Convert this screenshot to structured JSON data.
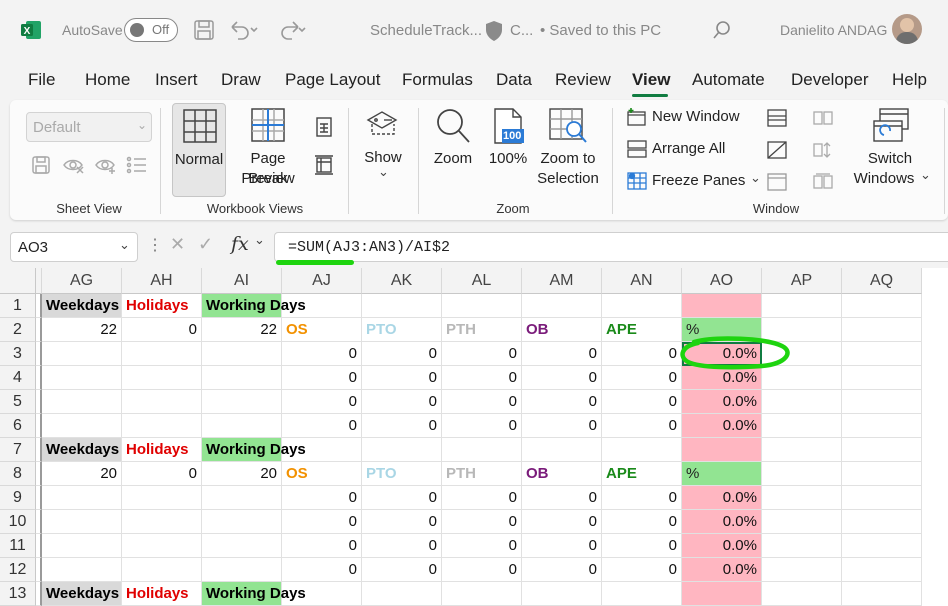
{
  "titlebar": {
    "autosave_label": "AutoSave",
    "autosave_state": "Off",
    "filename": "ScheduleTrack...",
    "sensitivity": "C...",
    "saved_status": "• Saved to this PC",
    "user_name": "Danielito ANDAG"
  },
  "menu": {
    "tabs": [
      "File",
      "Home",
      "Insert",
      "Draw",
      "Page Layout",
      "Formulas",
      "Data",
      "Review",
      "View",
      "Automate",
      "Developer",
      "Help"
    ],
    "active": "View"
  },
  "ribbon": {
    "sheet_view": {
      "default_select": "Default",
      "label": "Sheet View"
    },
    "workbook_views": {
      "normal": "Normal",
      "page_break_line1": "Page Break",
      "page_break_line2": "Preview",
      "label": "Workbook Views"
    },
    "show": {
      "label": "Show"
    },
    "zoom": {
      "zoom": "Zoom",
      "hundred": "100%",
      "hundred_icon": "100",
      "to_sel_line1": "Zoom to",
      "to_sel_line2": "Selection",
      "label": "Zoom"
    },
    "window": {
      "new_window": "New Window",
      "arrange_all": "Arrange All",
      "freeze_panes": "Freeze Panes",
      "switch_line1": "Switch",
      "switch_line2": "Windows",
      "label": "Window"
    }
  },
  "formula_bar": {
    "name_box": "AO3",
    "fx": "fx",
    "formula": "=SUM(AJ3:AN3)/AI$2",
    "highlight_color": "#1ed40f"
  },
  "sheet": {
    "columns": [
      "AG",
      "AH",
      "AI",
      "AJ",
      "AK",
      "AL",
      "AM",
      "AN",
      "AO",
      "AP",
      "AQ"
    ],
    "row_numbers": [
      "1",
      "2",
      "3",
      "4",
      "5",
      "6",
      "7",
      "8",
      "9",
      "10",
      "11",
      "12",
      "13"
    ],
    "header_labels": {
      "weekdays": "Weekdays",
      "holidays": "Holidays",
      "working_days": "Working Days"
    },
    "cat_labels": {
      "os": "OS",
      "pto": "PTO",
      "pth": "PTH",
      "ob": "OB",
      "ape": "APE",
      "pct": "%"
    },
    "block1": {
      "weekdays": "22",
      "holidays": "0",
      "working": "22"
    },
    "block2": {
      "weekdays": "20",
      "holidays": "0",
      "working": "20"
    },
    "zero": "0",
    "pct_value": "0.0%",
    "colors": {
      "holidays": "#e00000",
      "weekdays_bg": "#d9d9d9",
      "working_bg": "#92e492",
      "os": "#f29100",
      "pto": "#a9d6e5",
      "pth": "#b8b8b8",
      "ob": "#7a1b7a",
      "ape": "#1a8a1a",
      "pct_bg": "#ffb6c1",
      "pct_header_bg": "#92e492"
    }
  }
}
